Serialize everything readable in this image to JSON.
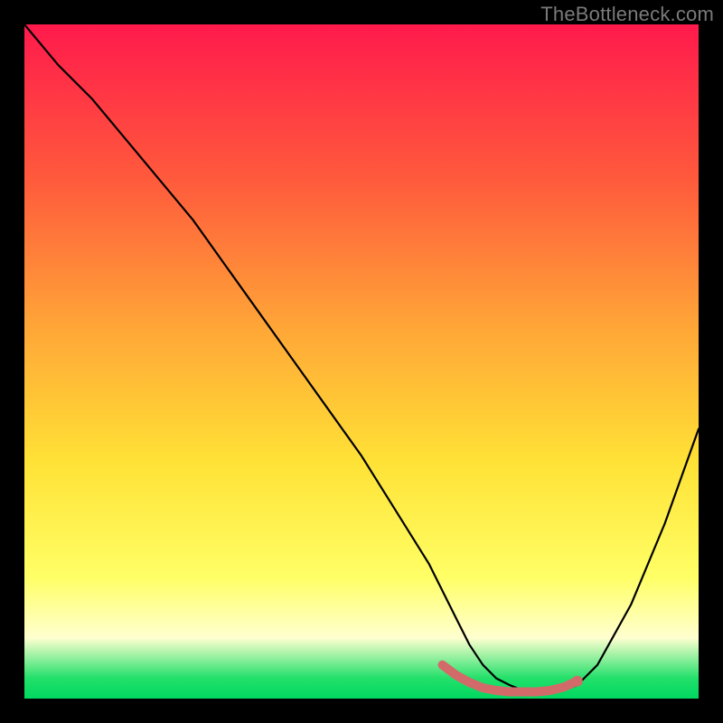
{
  "watermark": "TheBottleneck.com",
  "chart_data": {
    "type": "line",
    "title": "",
    "xlabel": "",
    "ylabel": "",
    "xlim": [
      0,
      100
    ],
    "ylim": [
      0,
      100
    ],
    "series": [
      {
        "name": "bottleneck-curve",
        "x": [
          0,
          5,
          10,
          15,
          20,
          25,
          30,
          35,
          40,
          45,
          50,
          55,
          60,
          62,
          64,
          66,
          68,
          70,
          72,
          74,
          76,
          78,
          80,
          82,
          85,
          90,
          95,
          100
        ],
        "values": [
          100,
          94,
          89,
          83,
          77,
          71,
          64,
          57,
          50,
          43,
          36,
          28,
          20,
          16,
          12,
          8,
          5,
          3,
          2,
          1.2,
          1,
          1,
          1.2,
          2,
          5,
          14,
          26,
          40
        ]
      },
      {
        "name": "optimal-range-marker",
        "x": [
          62,
          64,
          66,
          68,
          70,
          72,
          74,
          76,
          78,
          80,
          82
        ],
        "values": [
          5,
          3.5,
          2.4,
          1.6,
          1.2,
          1.0,
          1.0,
          1.0,
          1.2,
          1.7,
          2.6
        ]
      }
    ],
    "colors": {
      "curve": "#000000",
      "marker": "#d36a6a"
    }
  }
}
